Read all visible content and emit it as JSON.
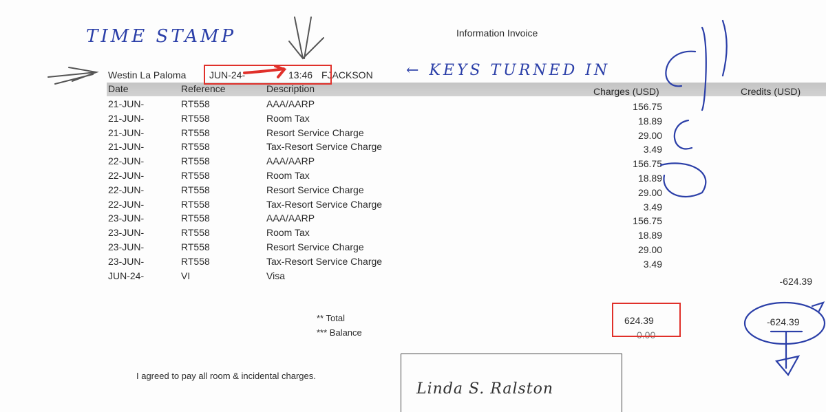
{
  "title": "Information Invoice",
  "annotations": {
    "time_stamp": "TIME STAMP",
    "keys_turned_in": "← KEYS TURNED IN",
    "ink_color": "#2b3fa8",
    "highlight_color": "#e0302a"
  },
  "header": {
    "hotel": "Westin La Paloma",
    "date": "JUN-24-",
    "time": "13:46",
    "clerk": "FJACKSON"
  },
  "columns": {
    "date": "Date",
    "reference": "Reference",
    "description": "Description",
    "charges": "Charges (USD)",
    "credits": "Credits (USD)"
  },
  "rows": [
    {
      "date": "21-JUN-",
      "ref": "RT558",
      "desc": "AAA/AARP",
      "charge": "156.75",
      "credit": ""
    },
    {
      "date": "21-JUN-",
      "ref": "RT558",
      "desc": "Room Tax",
      "charge": "18.89",
      "credit": ""
    },
    {
      "date": "21-JUN-",
      "ref": "RT558",
      "desc": "Resort Service Charge",
      "charge": "29.00",
      "credit": ""
    },
    {
      "date": "21-JUN-",
      "ref": "RT558",
      "desc": "Tax-Resort Service Charge",
      "charge": "3.49",
      "credit": ""
    },
    {
      "date": "22-JUN-",
      "ref": "RT558",
      "desc": "AAA/AARP",
      "charge": "156.75",
      "credit": ""
    },
    {
      "date": "22-JUN-",
      "ref": "RT558",
      "desc": "Room Tax",
      "charge": "18.89",
      "credit": ""
    },
    {
      "date": "22-JUN-",
      "ref": "RT558",
      "desc": "Resort Service Charge",
      "charge": "29.00",
      "credit": ""
    },
    {
      "date": "22-JUN-",
      "ref": "RT558",
      "desc": "Tax-Resort Service Charge",
      "charge": "3.49",
      "credit": ""
    },
    {
      "date": "23-JUN-",
      "ref": "RT558",
      "desc": "AAA/AARP",
      "charge": "156.75",
      "credit": ""
    },
    {
      "date": "23-JUN-",
      "ref": "RT558",
      "desc": "Room Tax",
      "charge": "18.89",
      "credit": ""
    },
    {
      "date": "23-JUN-",
      "ref": "RT558",
      "desc": "Resort Service Charge",
      "charge": "29.00",
      "credit": ""
    },
    {
      "date": "23-JUN-",
      "ref": "RT558",
      "desc": "Tax-Resort Service Charge",
      "charge": "3.49",
      "credit": ""
    },
    {
      "date": "JUN-24-",
      "ref": "VI",
      "desc": "Visa",
      "charge": "",
      "credit": "-624.39"
    }
  ],
  "totals": {
    "total_label": "** Total",
    "total_charges": "624.39",
    "total_credits": "-624.39",
    "balance_label": "*** Balance",
    "balance": "0.00"
  },
  "agreement": "I agreed to pay all room & incidental charges.",
  "signature": "Linda S. Ralston"
}
